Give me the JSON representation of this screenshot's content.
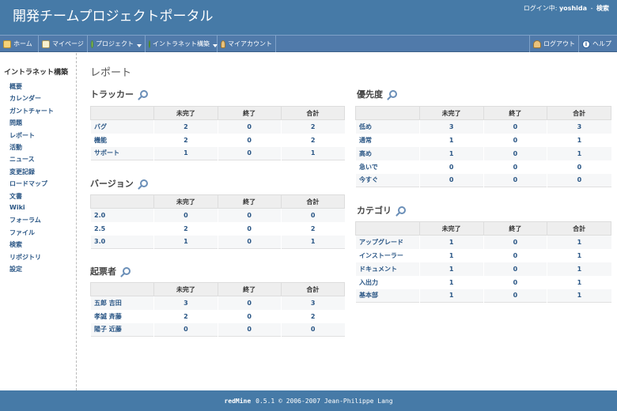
{
  "header": {
    "title": "開発チームプロジェクトポータル",
    "logged_as_label": "ログイン中:",
    "username": "yoshida",
    "separator": "-",
    "search_label": "検索"
  },
  "top_menu": {
    "home": "ホーム",
    "my_page": "マイページ",
    "projects": "プロジェクト",
    "intranet": "イントラネット構築",
    "my_account": "マイアカウント",
    "logout": "ログアウト",
    "help": "ヘルプ"
  },
  "sidebar": {
    "title": "イントラネット構築",
    "items": [
      "概要",
      "カレンダー",
      "ガントチャート",
      "問題",
      "レポート",
      "活動",
      "ニュース",
      "変更記録",
      "ロードマップ",
      "文書",
      "Wiki",
      "フォーラム",
      "ファイル",
      "検索",
      "リポジトリ",
      "設定"
    ]
  },
  "page": {
    "title": "レポート"
  },
  "columns": [
    "未完了",
    "終了",
    "合計"
  ],
  "sections": {
    "tracker": {
      "title": "トラッカー",
      "rows": [
        [
          "バグ",
          "2",
          "0",
          "2"
        ],
        [
          "機能",
          "2",
          "0",
          "2"
        ],
        [
          "サポート",
          "1",
          "0",
          "1"
        ]
      ]
    },
    "version": {
      "title": "バージョン",
      "rows": [
        [
          "2.0",
          "0",
          "0",
          "0"
        ],
        [
          "2.5",
          "2",
          "0",
          "2"
        ],
        [
          "3.0",
          "1",
          "0",
          "1"
        ]
      ]
    },
    "author": {
      "title": "起票者",
      "rows": [
        [
          "五郎 吉田",
          "3",
          "0",
          "3"
        ],
        [
          "孝誠 斉藤",
          "2",
          "0",
          "2"
        ],
        [
          "陽子 近藤",
          "0",
          "0",
          "0"
        ]
      ]
    },
    "priority": {
      "title": "優先度",
      "rows": [
        [
          "低め",
          "3",
          "0",
          "3"
        ],
        [
          "通常",
          "1",
          "0",
          "1"
        ],
        [
          "高め",
          "1",
          "0",
          "1"
        ],
        [
          "急いで",
          "0",
          "0",
          "0"
        ],
        [
          "今すぐ",
          "0",
          "0",
          "0"
        ]
      ]
    },
    "category": {
      "title": "カテゴリ",
      "rows": [
        [
          "アップグレード",
          "1",
          "0",
          "1"
        ],
        [
          "インストーラー",
          "1",
          "0",
          "1"
        ],
        [
          "ドキュメント",
          "1",
          "0",
          "1"
        ],
        [
          "入出力",
          "1",
          "0",
          "1"
        ],
        [
          "基本部",
          "1",
          "0",
          "1"
        ]
      ]
    }
  },
  "footer": {
    "brand": "redMine",
    "text": "0.5.1 © 2006-2007 Jean-Philippe Lang"
  },
  "colors": {
    "header_bg": "#467aa7",
    "link": "#2a5685",
    "table_header_bg": "#eeeeee"
  },
  "icons": [
    "home-icon",
    "my-page-icon",
    "projects-icon",
    "intranet-icon",
    "account-icon",
    "logout-icon",
    "help-icon",
    "zoom-icon",
    "dropdown-caret-icon"
  ]
}
